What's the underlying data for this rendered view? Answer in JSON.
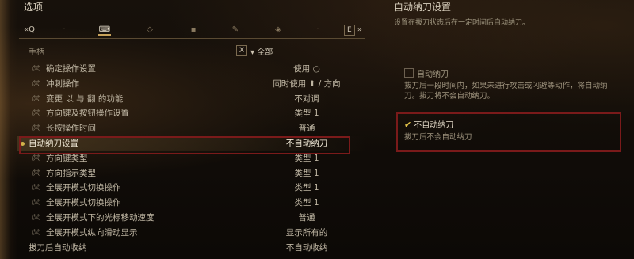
{
  "window": {
    "title": "选项"
  },
  "tabbar": {
    "left_key": "«Q",
    "right_key": "E",
    "right_arrow": "»",
    "icons": [
      "gamepad-icon",
      "keyboard-icon",
      "display-icon",
      "sound-icon",
      "ui-icon",
      "camera-icon",
      "accessibility-icon",
      "network-icon"
    ]
  },
  "filter": {
    "label": "手柄",
    "x_label": "X",
    "scope": "▾ 全部"
  },
  "list": {
    "rows": [
      {
        "label": "确定操作设置",
        "value": "使用 ○"
      },
      {
        "label": "冲刺操作",
        "value": "同时使用 ⬆ / 方向"
      },
      {
        "label": "变更 以 与 翻 的功能",
        "value": "不对调"
      },
      {
        "label": "方向键及按钮操作设置",
        "value": "类型 1"
      },
      {
        "label": "长按操作时间",
        "value": "普通"
      },
      {
        "label": "自动纳刀设置",
        "value": "不自动纳刀"
      },
      {
        "label": "方向键类型",
        "value": "类型 1"
      },
      {
        "label": "方向指示类型",
        "value": "类型 1"
      },
      {
        "label": "全展开模式切换操作",
        "value": "类型 1"
      },
      {
        "label": "全展开模式切换操作",
        "value": "类型 1"
      },
      {
        "label": "全展开模式下的光标移动速度",
        "value": "普通"
      },
      {
        "label": "全展开模式纵向滑动显示",
        "value": "显示所有的"
      },
      {
        "label": "拔刀后自动收纳",
        "value": "不自动收纳"
      }
    ]
  },
  "detail": {
    "title": "自动纳刀设置",
    "description": "设置在拔刀状态后在一定时间后自动纳刀。",
    "option1": {
      "label": "自动纳刀",
      "desc": "拔刀后一段时间内，如果未进行攻击或闪避等动作，将自动纳刀。拔刀将不会自动纳刀。"
    },
    "option2": {
      "label": "不自动纳刀",
      "desc": "拔刀后不会自动纳刀"
    }
  },
  "colors": {
    "highlight": "#7a1a1a",
    "accent": "#d2b24a"
  }
}
